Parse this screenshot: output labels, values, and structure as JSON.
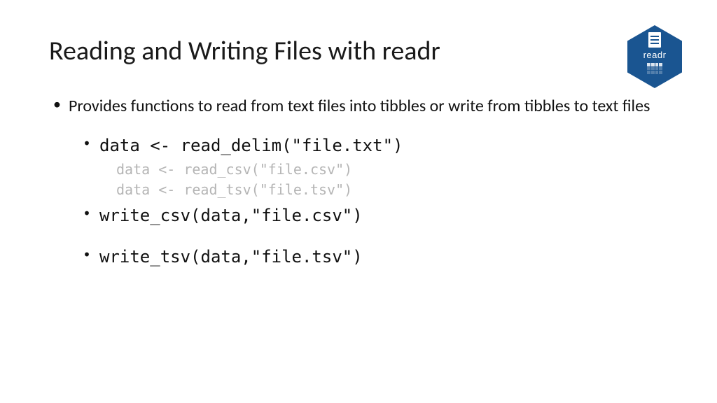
{
  "title": "Reading and Writing Files with readr",
  "logo_label": "readr",
  "bullets": {
    "intro": "Provides functions to read from text files into tibbles or write from tibbles to text files",
    "code1": "data <- read_delim(\"file.txt\")",
    "sub1": "data <- read_csv(\"file.csv\")",
    "sub2": "data <- read_tsv(\"file.tsv\")",
    "code2": "write_csv(data,\"file.csv\")",
    "code3": "write_tsv(data,\"file.tsv\")"
  }
}
